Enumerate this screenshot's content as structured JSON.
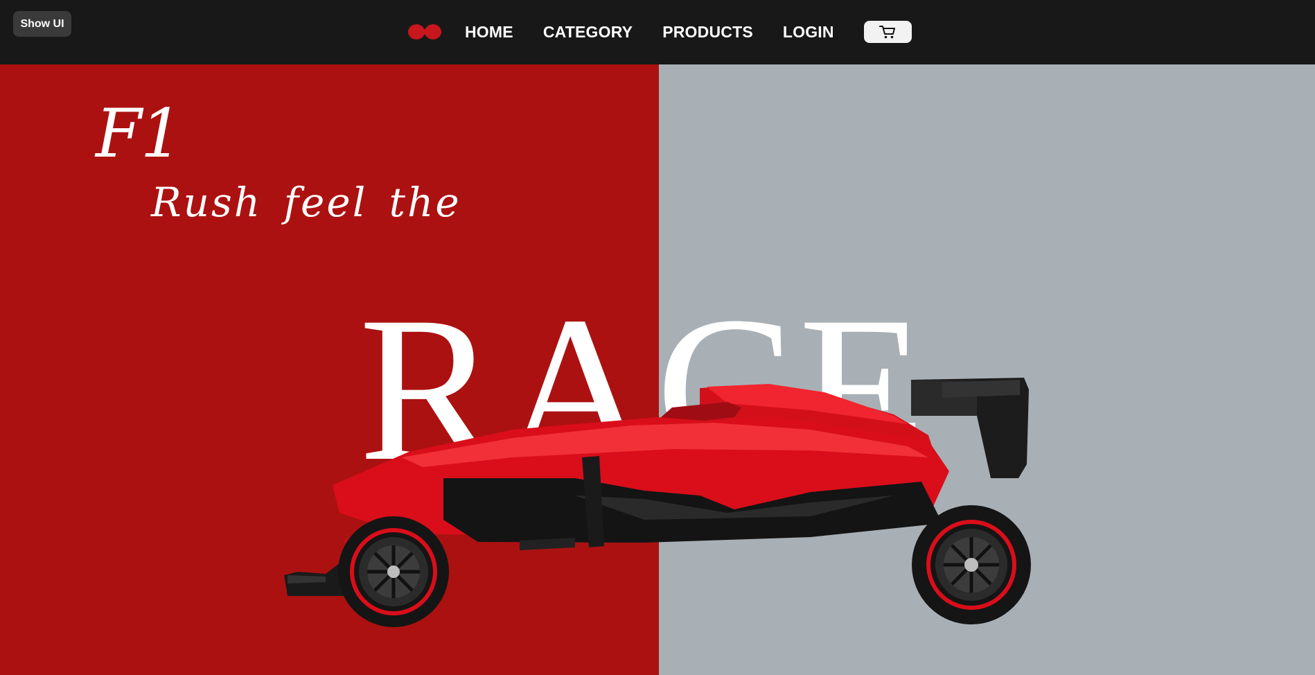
{
  "toolbar": {
    "show_ui_label": "Show UI"
  },
  "nav": {
    "logo_icon": "f1-logo-icon",
    "items": [
      {
        "label": "HOME"
      },
      {
        "label": "CATEGORY"
      },
      {
        "label": "PRODUCTS"
      },
      {
        "label": "LOGIN"
      }
    ],
    "cart_icon": "cart-icon"
  },
  "hero": {
    "script_title": "F1",
    "tagline": "Rush feel the",
    "headline": "RACE",
    "image": "red-formula-1-car"
  },
  "colors": {
    "topbar": "#181818",
    "left_panel": "#ac1111",
    "right_panel": "#a9b0b5",
    "accent_red": "#c8161d",
    "text": "#ffffff"
  }
}
